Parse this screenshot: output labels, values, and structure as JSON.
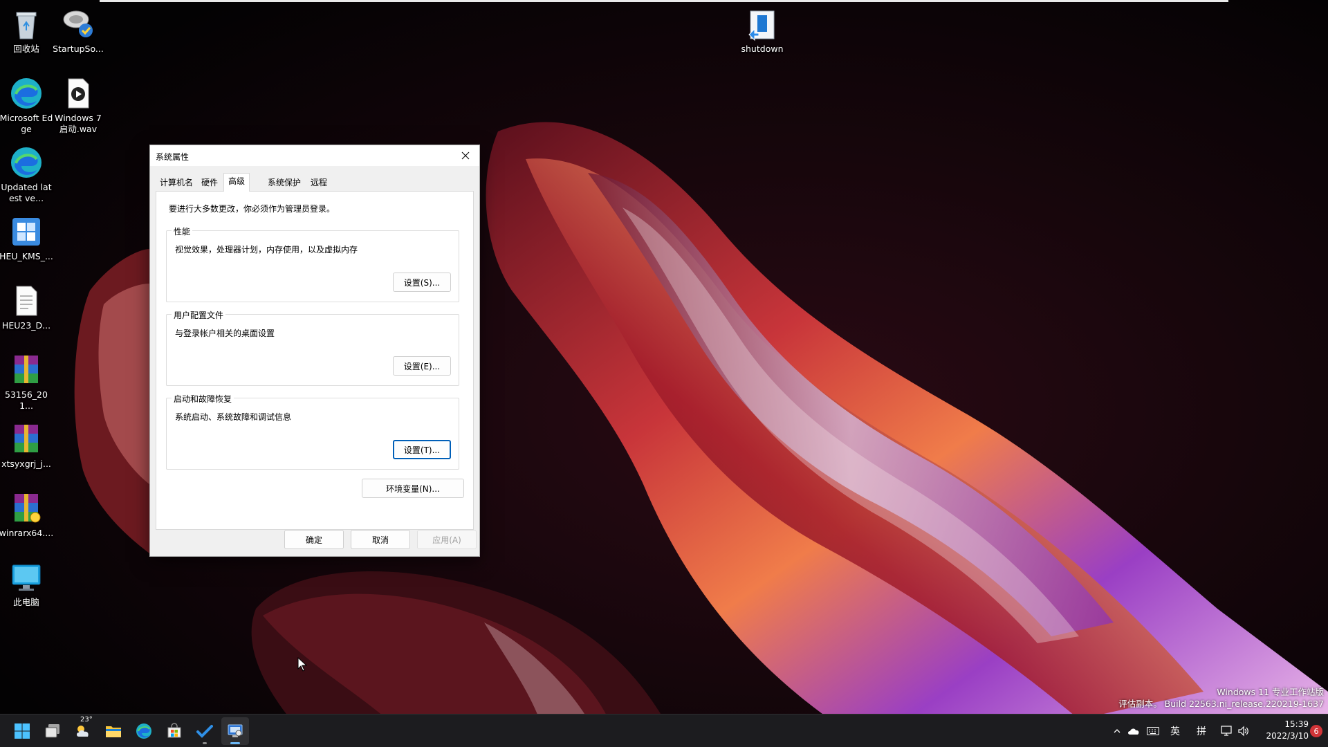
{
  "desktop": {
    "icons": [
      {
        "label": "回收站",
        "icon": "recycle-bin-icon"
      },
      {
        "label": "StartupSo...",
        "icon": "startup-sound-icon"
      },
      {
        "label": "shutdown",
        "icon": "shutdown-shortcut-icon"
      },
      {
        "label": "Microsoft Edge",
        "icon": "edge-icon"
      },
      {
        "label": "Windows 7 启动.wav",
        "icon": "wav-file-icon"
      },
      {
        "label": "Updated latest ve...",
        "icon": "edge-update-icon"
      },
      {
        "label": "HEU_KMS_...",
        "icon": "heu-kms-icon"
      },
      {
        "label": "HEU23_D...",
        "icon": "text-file-icon"
      },
      {
        "label": "53156_201...",
        "icon": "winrar-archive-icon"
      },
      {
        "label": "xtsyxgrj_j...",
        "icon": "winrar-archive-icon"
      },
      {
        "label": "winrarx64....",
        "icon": "winrar-installer-icon"
      },
      {
        "label": "此电脑",
        "icon": "this-pc-icon"
      }
    ]
  },
  "dialog": {
    "title": "系统属性",
    "tabs": [
      {
        "label": "计算机名",
        "active": false
      },
      {
        "label": "硬件",
        "active": false
      },
      {
        "label": "高级",
        "active": true
      },
      {
        "label": "系统保护",
        "active": false
      },
      {
        "label": "远程",
        "active": false
      }
    ],
    "intro": "要进行大多数更改，你必须作为管理员登录。",
    "groups": [
      {
        "title": "性能",
        "description": "视觉效果，处理器计划，内存使用，以及虚拟内存",
        "button": "设置(S)..."
      },
      {
        "title": "用户配置文件",
        "description": "与登录帐户相关的桌面设置",
        "button": "设置(E)..."
      },
      {
        "title": "启动和故障恢复",
        "description": "系统启动、系统故障和调试信息",
        "button": "设置(T)..."
      }
    ],
    "env_button": "环境变量(N)...",
    "ok": "确定",
    "cancel": "取消",
    "apply": "应用(A)"
  },
  "taskbar": {
    "weather_temp": "23°",
    "tray": {
      "ime_lang": "英",
      "ime_mode": "拼",
      "time": "15:39",
      "date": "2022/3/10",
      "notifications": "6"
    }
  },
  "watermark": {
    "line1": "Windows 11 专业工作站版",
    "line2": "评估副本。 Build 22563.ni_release.220219-1637"
  },
  "colors": {
    "accent": "#005fb8",
    "taskbar": "#1c1c1f",
    "dialog_bg": "#f0f0f0"
  }
}
